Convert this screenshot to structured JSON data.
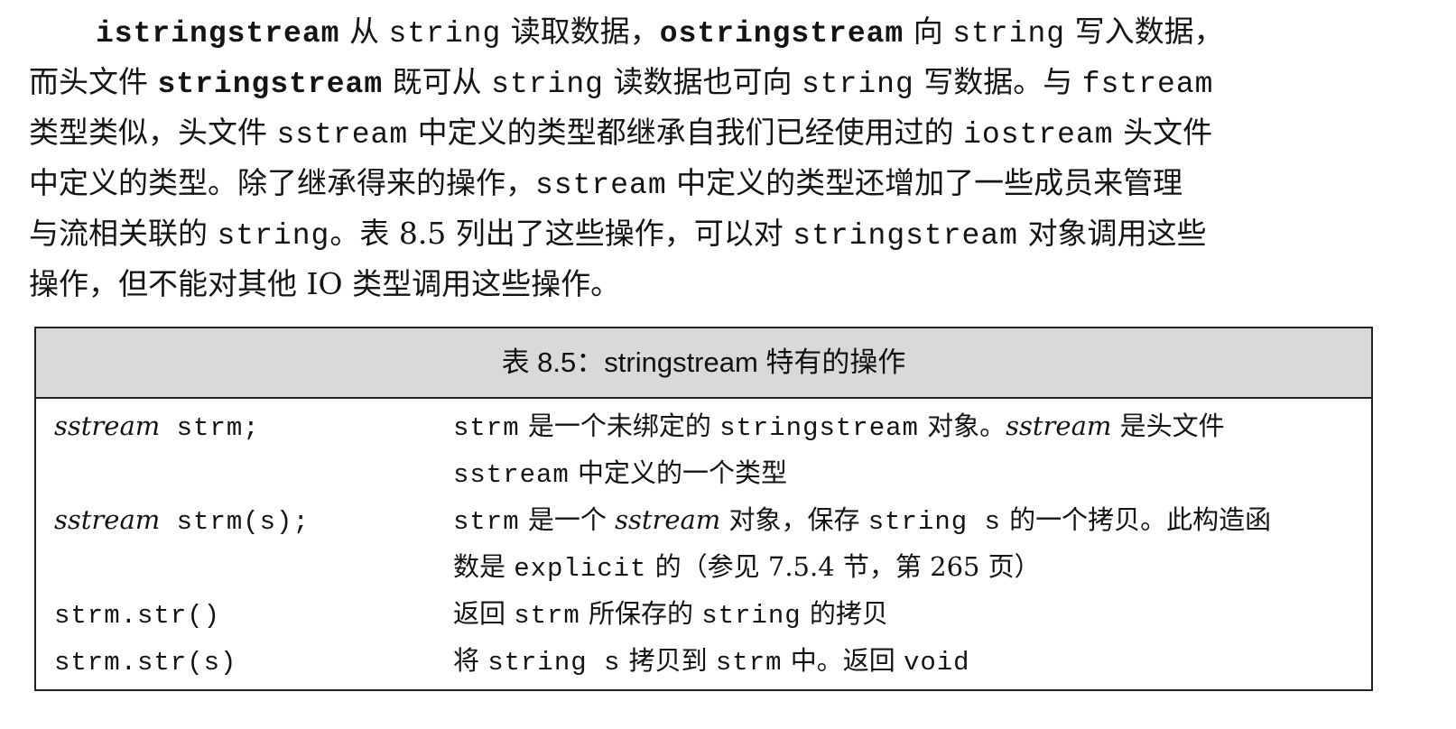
{
  "paragraph": {
    "l1": {
      "w1": "istringstream",
      "t1": "从",
      "w2": "string",
      "t2": "读取数据，",
      "w3": "ostringstream",
      "t3": "向",
      "w4": "string",
      "t4": "写入数据，"
    },
    "l2": {
      "t1": "而头文件",
      "w1": "stringstream",
      "t2": "既可从",
      "w2": "string",
      "t3": "读数据也可向",
      "w3": "string",
      "t4": "写数据。与",
      "w4": "fstream"
    },
    "l3": {
      "t1": "类型类似，头文件",
      "w1": "sstream",
      "t2": "中定义的类型都继承自我们已经使用过的",
      "w2": "iostream",
      "t3": "头文件"
    },
    "l4": {
      "t1": "中定义的类型。除了继承得来的操作，",
      "w1": "sstream",
      "t2": "中定义的类型还增加了一些成员来管理"
    },
    "l5": {
      "t1": "与流相关联的",
      "w1": "string",
      "t2": "。表 8.5 列出了这些操作，可以对",
      "w2": "stringstream",
      "t3": "对象调用这些"
    },
    "l6": {
      "t1": "操作，但不能对其他 IO 类型调用这些操作。"
    }
  },
  "table": {
    "caption": "表 8.5：stringstream 特有的操作",
    "rows": [
      {
        "code_it": "sstream",
        "code": " strm;",
        "d1": {
          "a": "strm",
          "b": " 是一个未绑定的 ",
          "c": "stringstream",
          "d": " 对象。",
          "e": "sstream",
          "f": " 是头文件"
        },
        "d2": {
          "a": "sstream",
          "b": " 中定义的一个类型"
        }
      },
      {
        "code_it": "sstream",
        "code": " strm(s);",
        "d1": {
          "a": "strm",
          "b": " 是一个 ",
          "c": "sstream",
          "d": " 对象，保存 ",
          "e": "string s",
          "f": " 的一个拷贝。此构造函"
        },
        "d2": {
          "a": "数是 ",
          "b": "explicit",
          "c": " 的（参见 7.5.4 节，第 265 页）"
        }
      },
      {
        "code": "strm.str()",
        "d1": {
          "a": "返回 ",
          "b": "strm",
          "c": " 所保存的 ",
          "d": "string",
          "e": " 的拷贝"
        }
      },
      {
        "code": "strm.str(s)",
        "d1": {
          "a": "将 ",
          "b": "string s",
          "c": " 拷贝到 ",
          "d": "strm",
          "e": " 中。返回 ",
          "f": "void"
        }
      }
    ]
  }
}
